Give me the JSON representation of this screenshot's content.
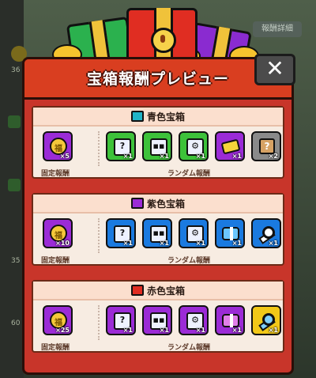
{
  "background": {
    "button_label": "報酬詳細",
    "side_stats": [
      "36",
      "35",
      "60"
    ]
  },
  "panel": {
    "title": "宝箱報酬プレビュー",
    "close_label": "✕"
  },
  "labels": {
    "fixed": "固定報酬",
    "random": "ランダム報酬"
  },
  "sections": [
    {
      "title": "青色宝箱",
      "chest_color": "#1fb4c8",
      "fixed": {
        "count": "×5"
      },
      "random": [
        {
          "type": "question-box",
          "count": "×1"
        },
        {
          "type": "robot-box",
          "count": "×1"
        },
        {
          "type": "gear-box",
          "count": "×1"
        },
        {
          "type": "ticket",
          "count": "×1"
        },
        {
          "type": "mystery-crate",
          "count": "×2"
        }
      ]
    },
    {
      "title": "紫色宝箱",
      "chest_color": "#9b2bd6",
      "fixed": {
        "count": "×10"
      },
      "random": [
        {
          "type": "question-box",
          "count": "×1"
        },
        {
          "type": "robot-box",
          "count": "×1"
        },
        {
          "type": "gear-box",
          "count": "×1"
        },
        {
          "type": "bundle",
          "count": "×1"
        },
        {
          "type": "key",
          "count": "×1"
        }
      ]
    },
    {
      "title": "赤色宝箱",
      "chest_color": "#e02d22",
      "fixed": {
        "count": "×25"
      },
      "random": [
        {
          "type": "question-box",
          "count": "×1"
        },
        {
          "type": "robot-box",
          "count": "×1"
        },
        {
          "type": "gear-box",
          "count": "×1"
        },
        {
          "type": "bundle",
          "count": "×1"
        },
        {
          "type": "key",
          "count": "×1"
        }
      ]
    }
  ],
  "token_glyph": "福",
  "colors": {
    "panel": "#c8352a",
    "header": "#d93e20",
    "section_bg": "#f7ece2"
  }
}
